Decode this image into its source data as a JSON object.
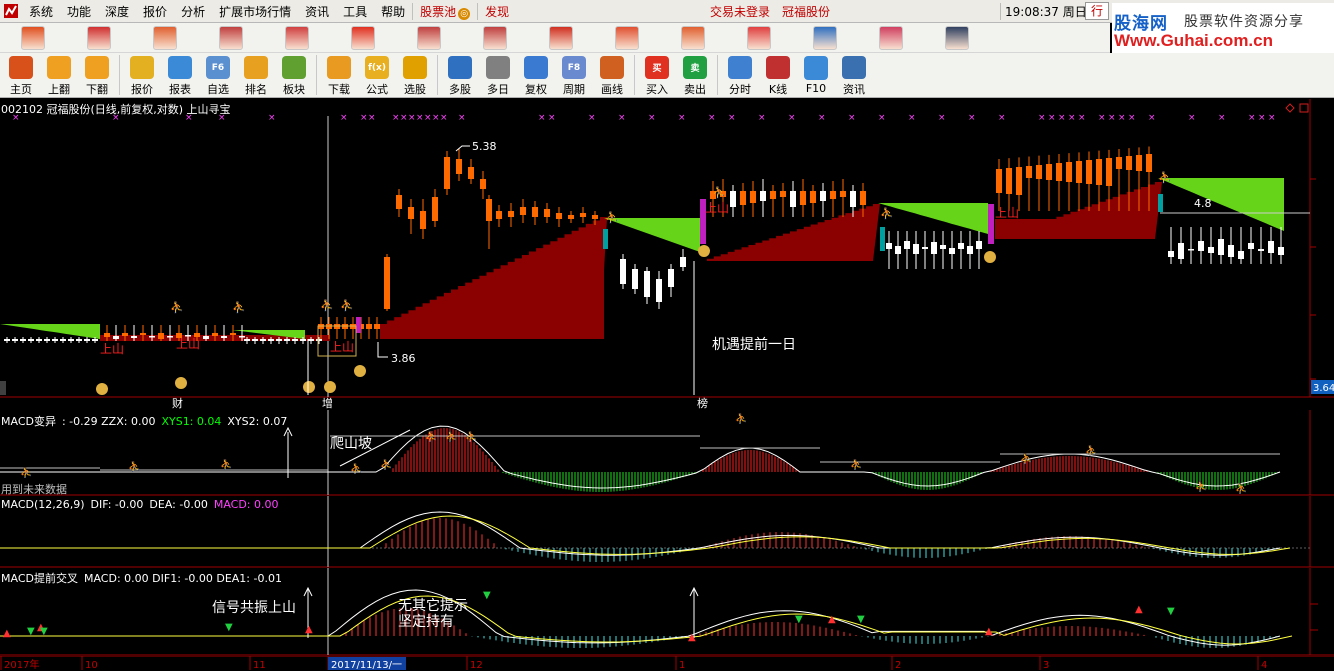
{
  "menu": {
    "items": [
      "系统",
      "功能",
      "深度",
      "报价",
      "分析",
      "扩展市场行情",
      "资讯",
      "工具",
      "帮助"
    ],
    "stock_pool": "股票池",
    "discover": "发现",
    "trade_status": "交易未登录",
    "stock_name": "冠福股份",
    "clock": "19:08:37 周日",
    "hang_label": "行"
  },
  "brand": {
    "name": "股海网",
    "slogan": "股票软件资源分享",
    "url": "Www.Guhai.com.cn"
  },
  "toolbar": [
    {
      "label": "主页",
      "icon": "home-icon",
      "color": "#d8501a"
    },
    {
      "label": "上翻",
      "icon": "arrow-up-icon",
      "color": "#f0a020"
    },
    {
      "label": "下翻",
      "icon": "arrow-down-icon",
      "color": "#f0a020"
    },
    {
      "label": "报价",
      "icon": "yuan-icon",
      "color": "#e2b020"
    },
    {
      "label": "报表",
      "icon": "table-icon",
      "color": "#3a8ad8"
    },
    {
      "label": "自选",
      "icon": "f6-icon",
      "color": "#5a8fd0",
      "text": "F6"
    },
    {
      "label": "排名",
      "icon": "rank-icon",
      "color": "#e8a020"
    },
    {
      "label": "板块",
      "icon": "blocks-icon",
      "color": "#60a030"
    },
    {
      "label": "下载",
      "icon": "download-icon",
      "color": "#e89b20"
    },
    {
      "label": "公式",
      "icon": "formula-icon",
      "color": "#e8b020",
      "text": "f(x)"
    },
    {
      "label": "选股",
      "icon": "pick-stock-icon",
      "color": "#e0a000"
    },
    {
      "label": "多股",
      "icon": "multi-stock-icon",
      "color": "#3070c0"
    },
    {
      "label": "多日",
      "icon": "clock-icon",
      "color": "#808080"
    },
    {
      "label": "复权",
      "icon": "restore-icon",
      "color": "#3a7ad0"
    },
    {
      "label": "周期",
      "icon": "f8-icon",
      "color": "#6a8ad0",
      "text": "F8"
    },
    {
      "label": "画线",
      "icon": "draw-line-icon",
      "color": "#d06020"
    },
    {
      "label": "买入",
      "icon": "buy-icon",
      "color": "#e03020",
      "text": "买"
    },
    {
      "label": "卖出",
      "icon": "sell-icon",
      "color": "#20a040",
      "text": "卖"
    },
    {
      "label": "分时",
      "icon": "intraday-icon",
      "color": "#4080d0"
    },
    {
      "label": "K线",
      "icon": "kline-icon",
      "color": "#c03030"
    },
    {
      "label": "F10",
      "icon": "f10-icon",
      "color": "#3a8ad8"
    },
    {
      "label": "资讯",
      "icon": "news-icon",
      "color": "#3a70b0"
    }
  ],
  "main_panel": {
    "title": "002102 冠福股份(日线,前复权,对数) 上山寻宝",
    "high_label": "5.38",
    "low_label": "3.86",
    "right_level": "4.8",
    "price_tag": "3.64",
    "annotation": "机遇提前一日",
    "upward_label": "上山",
    "marker_labels": [
      "财",
      "增",
      "榜"
    ],
    "colors": {
      "up": "#ff6a00",
      "down": "#ffffff",
      "red_fill": "#8b0000",
      "green_fill": "#66d419"
    }
  },
  "macd_variant": {
    "name": "MACD变异",
    "values_text": ": -0.29  ZZX: 0.00",
    "xys1": "XYS1: 0.04",
    "xys2": "XYS2: 0.07",
    "annotation": "爬山坡",
    "note": "用到未来数据"
  },
  "macd": {
    "title": "MACD(12,26,9)",
    "dif": "DIF: -0.00",
    "dea": "DEA: -0.00",
    "macd_val": "MACD: 0.00"
  },
  "macd_early": {
    "title": "MACD提前交叉",
    "values": "MACD: 0.00  DIF1: -0.00  DEA1: -0.01",
    "annotation1": "信号共振上山",
    "annotation2": "无其它提示",
    "annotation3": "坚定持有"
  },
  "xaxis": {
    "labels": [
      "2017年",
      "10",
      "11",
      "2017/11/13/一",
      "12",
      "1",
      "2",
      "3",
      "4"
    ]
  }
}
